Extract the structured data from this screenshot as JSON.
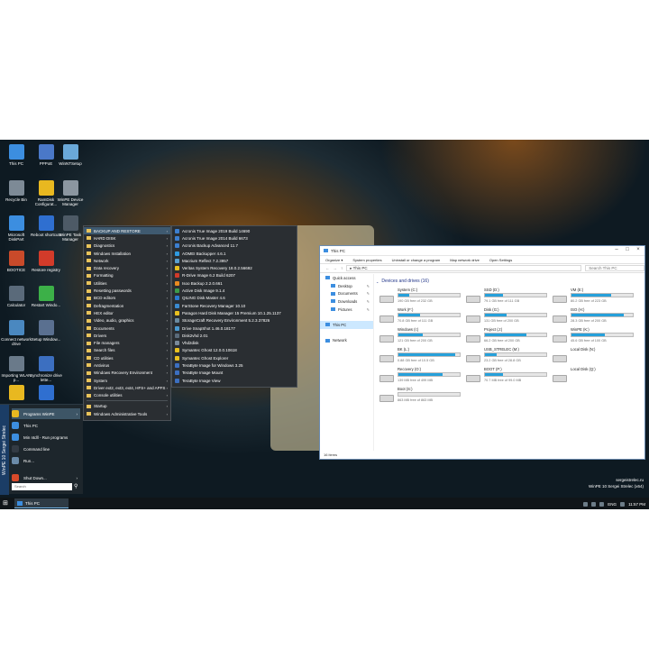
{
  "desktop": {
    "icons": [
      {
        "label": "This PC",
        "color": "#3c8ee0"
      },
      {
        "label": "PPPoE",
        "color": "#4a78c8"
      },
      {
        "label": "WinNTSetup",
        "color": "#6aa8d8"
      },
      {
        "label": "Recycle Bin",
        "color": "#7d8a96"
      },
      {
        "label": "RamDisk Configurat...",
        "color": "#e8b820"
      },
      {
        "label": "WinPE Device Manager",
        "color": "#8b96a0"
      },
      {
        "label": "Microsoft DiskPart",
        "color": "#3c8ee0"
      },
      {
        "label": "Reboot shortcuts",
        "color": "#2f6fd0"
      },
      {
        "label": "WinPE Task Manager",
        "color": "#4d5a66"
      },
      {
        "label": "BOOTICE",
        "color": "#c94a2a"
      },
      {
        "label": "Restore registry",
        "color": "#d23b2a"
      },
      {
        "label": "Calculator",
        "color": "#5a6a7a"
      },
      {
        "label": "Restart Windo...",
        "color": "#3cb048"
      },
      {
        "label": "Connect network drive",
        "color": "#4a88c0"
      },
      {
        "label": "Setup Window...",
        "color": "#5a7090"
      },
      {
        "label": "Importing WLAN p...",
        "color": "#6a7a8a"
      },
      {
        "label": "Synchronize drive lette...",
        "color": "#3c6fc0"
      },
      {
        "label": "",
        "color": "#e8b820"
      },
      {
        "label": "",
        "color": "#2f6fd0"
      }
    ]
  },
  "start_menu": {
    "brand": "WinPE 10 Sergei Strelec",
    "items": [
      {
        "label": "Programs WinPE",
        "color": "#e8b820",
        "arrow": "›"
      },
      {
        "label": "This PC",
        "color": "#3c8ee0",
        "arrow": ""
      },
      {
        "label": "Min ntdll - Run programs",
        "color": "#3c8ee0",
        "arrow": ""
      },
      {
        "label": "Command line",
        "color": "#333b44",
        "arrow": ""
      },
      {
        "label": "Run...",
        "color": "#6a8aa8",
        "arrow": ""
      },
      {
        "label": "Shut Down...",
        "color": "#d84a2a",
        "arrow": "›"
      }
    ],
    "search_placeholder": "Search",
    "search_icon": "⚲"
  },
  "programs_menu": {
    "items": [
      {
        "label": "BACKUP AND RESTORE",
        "arrow": "›"
      },
      {
        "label": "HARD DISK",
        "arrow": "›"
      },
      {
        "label": "Diagnostics",
        "arrow": "›"
      },
      {
        "label": "Windows Installation",
        "arrow": "›"
      },
      {
        "label": "Network",
        "arrow": "›"
      },
      {
        "label": "Data recovery",
        "arrow": "›"
      },
      {
        "label": "Formatting",
        "arrow": "›"
      },
      {
        "label": "Utilities",
        "arrow": "›"
      },
      {
        "label": "Resetting passwords",
        "arrow": "›"
      },
      {
        "label": "BCD editors",
        "arrow": "›"
      },
      {
        "label": "Defragmentation",
        "arrow": "›"
      },
      {
        "label": "HEX editor",
        "arrow": "›"
      },
      {
        "label": "Video, audio, graphics",
        "arrow": "›"
      },
      {
        "label": "Documents",
        "arrow": "›"
      },
      {
        "label": "Drivers",
        "arrow": "›"
      },
      {
        "label": "File managers",
        "arrow": "›"
      },
      {
        "label": "Search files",
        "arrow": "›"
      },
      {
        "label": "CD utilities",
        "arrow": "›"
      },
      {
        "label": "Antivirus",
        "arrow": "›"
      },
      {
        "label": "Windows Recovery Environment",
        "arrow": "›"
      },
      {
        "label": "System",
        "arrow": "›"
      },
      {
        "label": "Driver ext2, ext3, ext4, HFS+ and APFS",
        "arrow": "›"
      },
      {
        "label": "Console utilities",
        "arrow": "›"
      },
      {
        "label": "",
        "arrow": ""
      },
      {
        "label": "Startup",
        "arrow": "›"
      },
      {
        "label": "Windows Administrative Tools",
        "arrow": "›"
      }
    ]
  },
  "backup_menu": {
    "items": [
      {
        "label": "Acronis True Image 2019 Build 14690",
        "color": "#3c7fd0"
      },
      {
        "label": "Acronis True Image 2014 Build 6673",
        "color": "#3c7fd0"
      },
      {
        "label": "Acronis Backup Advanced 11.7",
        "color": "#3c7fd0"
      },
      {
        "label": "AOMEI Backupper 4.6.1",
        "color": "#2f9ae0"
      },
      {
        "label": "Macrium Reflect 7.2.3957",
        "color": "#5aa0d0"
      },
      {
        "label": "Veritas System Recovery 18.0.2.56692",
        "color": "#e8c020"
      },
      {
        "label": "R-Drive Image 6.2 Build 6207",
        "color": "#d03a2a"
      },
      {
        "label": "Isoo Backup 2.2.0.661",
        "color": "#e88a20"
      },
      {
        "label": "Active Disk Image 9.1.4",
        "color": "#3c9a4a"
      },
      {
        "label": "QILING Disk Master 4.6",
        "color": "#2a7ad0"
      },
      {
        "label": "FarStone Recovery Manager 10.10",
        "color": "#3a8ad0"
      },
      {
        "label": "Paragon Hard Disk Manager 15 Premium 10.1.25.1137",
        "color": "#e8c020"
      },
      {
        "label": "StorageCraft Recovery Environment 5.2.3.37826",
        "color": "#6a8aa0"
      },
      {
        "label": "Drive SnapShot 1.46.0.18177",
        "color": "#4a9ad0"
      },
      {
        "label": "Disk2vhd 2.01",
        "color": "#5a6a7a"
      },
      {
        "label": "Vhd2disk",
        "color": "#7a8a9a"
      },
      {
        "label": "Symantec Ghost 12.0.0.10618",
        "color": "#e8c020"
      },
      {
        "label": "Symantec Ghost Explorer",
        "color": "#e8c020"
      },
      {
        "label": "TeraByte Image for Windows 3.25",
        "color": "#3c6fc0"
      },
      {
        "label": "TeraByte Image Mount",
        "color": "#3c6fc0"
      },
      {
        "label": "TeraByte Image View",
        "color": "#3c6fc0"
      }
    ]
  },
  "explorer": {
    "title": "This PC",
    "window_buttons": {
      "minimize": "–",
      "maximize": "□",
      "close": "×"
    },
    "ribbon": [
      "Organize ▾",
      "System properties",
      "Uninstall or change a program",
      "Map network drive",
      "Open Settings"
    ],
    "address": "▸ This PC",
    "search_placeholder": "Search This PC",
    "nav": [
      {
        "label": "Quick access",
        "sub": false,
        "pin": "",
        "selected": false
      },
      {
        "label": "Desktop",
        "sub": true,
        "pin": "✎",
        "selected": false
      },
      {
        "label": "Documents",
        "sub": true,
        "pin": "✎",
        "selected": false
      },
      {
        "label": "Downloads",
        "sub": true,
        "pin": "✎",
        "selected": false
      },
      {
        "label": "Pictures",
        "sub": true,
        "pin": "✎",
        "selected": false
      },
      {
        "label": "",
        "sub": false,
        "pin": "",
        "selected": false
      },
      {
        "label": "This PC",
        "sub": false,
        "pin": "",
        "selected": true
      },
      {
        "label": "",
        "sub": false,
        "pin": "",
        "selected": false
      },
      {
        "label": "Network",
        "sub": false,
        "pin": "",
        "selected": false
      }
    ],
    "group_title": "Devices and drives (16)",
    "drives": [
      {
        "name": "System (C:)",
        "free": "190 GB free of 232 GB",
        "used": 0.18
      },
      {
        "name": "SSD (D:)",
        "free": "79.1 GB free of 111 GB",
        "used": 0.29
      },
      {
        "name": "VM (E:)",
        "free": "80.2 GB free of 223 GB",
        "used": 0.64
      },
      {
        "name": "Work (F:)",
        "free": "70.8 GB free of 111 GB",
        "used": 0.36
      },
      {
        "name": "Disk (G:)",
        "free": "131 GB free of 200 GB",
        "used": 0.35
      },
      {
        "name": "ISO (H:)",
        "free": "28.3 GB free of 200 GB",
        "used": 0.86
      },
      {
        "name": "Windows (I:)",
        "free": "121 GB free of 200 GB",
        "used": 0.4
      },
      {
        "name": "Project (J:)",
        "free": "66.2 GB free of 200 GB",
        "used": 0.67
      },
      {
        "name": "WinPE (K:)",
        "free": "45.6 GB free of 100 GB",
        "used": 0.54
      },
      {
        "name": "BK (L:)",
        "free": "0.88 GB free of 10.5 GB",
        "used": 0.92
      },
      {
        "name": "USB_STRELEC (M:)",
        "free": "23.2 GB free of 28.8 GB",
        "used": 0.19
      },
      {
        "name": "Local Disk (N:)",
        "free": "",
        "used": -1
      },
      {
        "name": "Recovery (O:)",
        "free": "139 MB free of 499 MB",
        "used": 0.72
      },
      {
        "name": "BOOT (P:)",
        "free": "70.7 MB free of 99.0 MB",
        "used": 0.29
      },
      {
        "name": "Local Disk (Q:)",
        "free": "",
        "used": -1
      },
      {
        "name": "Boot (S:)",
        "free": "863 MB free of 863 MB",
        "used": 0.0
      }
    ],
    "status": "16 items"
  },
  "taskbar": {
    "start_icon": "⊞",
    "task_label": "This PC",
    "tray_lang": "ENG",
    "clock": "11:57 PM"
  },
  "watermark": {
    "line1": "sergeistrelec.ru",
    "line2": "WinPE 10 Sergei Strelec (x64)"
  }
}
